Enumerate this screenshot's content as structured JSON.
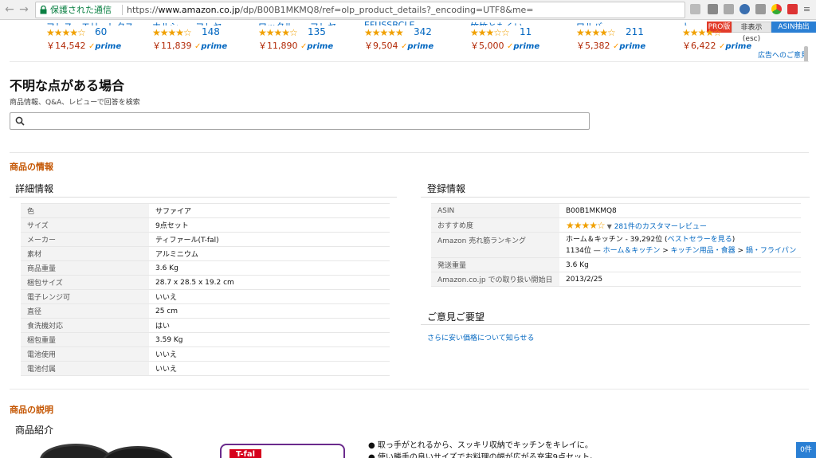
{
  "browser": {
    "secure_label": "保護された通信",
    "url_scheme": "https://",
    "url_host": "www.amazon.co.jp",
    "url_path": "/dp/B00B1MKMQ8/ref=olp_product_details?_encoding=UTF8&me=",
    "extensions": {
      "pro": "PRO版",
      "hide": "非表示(esc)",
      "asin": "ASIN抽出(11)"
    }
  },
  "carousel": [
    {
      "title_fragment": "フレス・エリ・レクス",
      "stars": "★★★★☆",
      "reviews": "60",
      "price": "￥14,542"
    },
    {
      "title_fragment": "ホルシーーフレヤ",
      "stars": "★★★★☆",
      "reviews": "148",
      "price": "￥11,839"
    },
    {
      "title_fragment": "ワックル・ーフレヤ",
      "stars": "★★★★☆",
      "reviews": "135",
      "price": "￥11,890"
    },
    {
      "title_fragment": "EFUSSBCLE",
      "stars": "★★★★★",
      "reviews": "342",
      "price": "￥9,504"
    },
    {
      "title_fragment": "竹竹ともくい",
      "stars": "★★★☆☆",
      "reviews": "11",
      "price": "￥5,000"
    },
    {
      "title_fragment": "ワルバ",
      "stars": "★★★★☆",
      "reviews": "211",
      "price": "￥5,382"
    },
    {
      "title_fragment": "トー",
      "stars": "★★★★☆",
      "reviews": "",
      "price": "￥6,422"
    }
  ],
  "prime_label": "prime",
  "ad_feedback": "広告へのご意見",
  "qa": {
    "title": "不明な点がある場合",
    "subtitle": "商品情報、Q&A、レビューで回答を検索",
    "placeholder": ""
  },
  "product_info": {
    "heading": "商品の情報",
    "details_heading": "詳細情報",
    "details": [
      {
        "k": "色",
        "v": "サファイア"
      },
      {
        "k": "サイズ",
        "v": "9点セット"
      },
      {
        "k": "メーカー",
        "v": "ティファール(T-fal)"
      },
      {
        "k": "素材",
        "v": "アルミニウム"
      },
      {
        "k": "商品重量",
        "v": "3.6 Kg"
      },
      {
        "k": "梱包サイズ",
        "v": "28.7 x 28.5 x 19.2 cm"
      },
      {
        "k": "電子レンジ可",
        "v": "いいえ"
      },
      {
        "k": "直径",
        "v": "25 cm"
      },
      {
        "k": "食洗機対応",
        "v": "はい"
      },
      {
        "k": "梱包重量",
        "v": "3.59 Kg"
      },
      {
        "k": "電池使用",
        "v": "いいえ"
      },
      {
        "k": "電池付属",
        "v": "いいえ"
      }
    ],
    "registration_heading": "登録情報",
    "asin_key": "ASIN",
    "asin": "B00B1MKMQ8",
    "rating_key": "おすすめ度",
    "rating_stars": "★★★★☆",
    "rating_reviews": "281件のカスタマーレビュー",
    "rank_key": "Amazon 売れ筋ランキング",
    "rank_line1": "ホーム＆キッチン - 39,292位 (",
    "rank_link1": "ベストセラーを見る",
    "rank_line1_end": ")",
    "rank_line2_prefix": "1134位 — ",
    "rank_cat1": "ホーム＆キッチン",
    "rank_cat2": "キッチン用品・食器",
    "rank_cat3": "鍋・フライパン",
    "ship_weight_key": "発送重量",
    "ship_weight": "3.6 Kg",
    "release_key": "Amazon.co.jp での取り扱い開始日",
    "release": "2013/2/25",
    "feedback_heading": "ご意見ご要望",
    "feedback_link": "さらに安い価格について知らせる"
  },
  "description": {
    "heading": "商品の説明",
    "intro": "商品紹介",
    "brand": "T-fal",
    "bullets": [
      "● 取っ手がとれるから、スッキリ収納でキッチンをキレイに。",
      "● 使い勝手の良いサイズでお料理の幅が広がる充実9点セット。"
    ]
  },
  "cart_badge": "0件",
  "colors": {
    "accent_orange": "#c45500",
    "link_blue": "#0066c0",
    "price_red": "#b12704",
    "star_gold": "#f0a000"
  }
}
